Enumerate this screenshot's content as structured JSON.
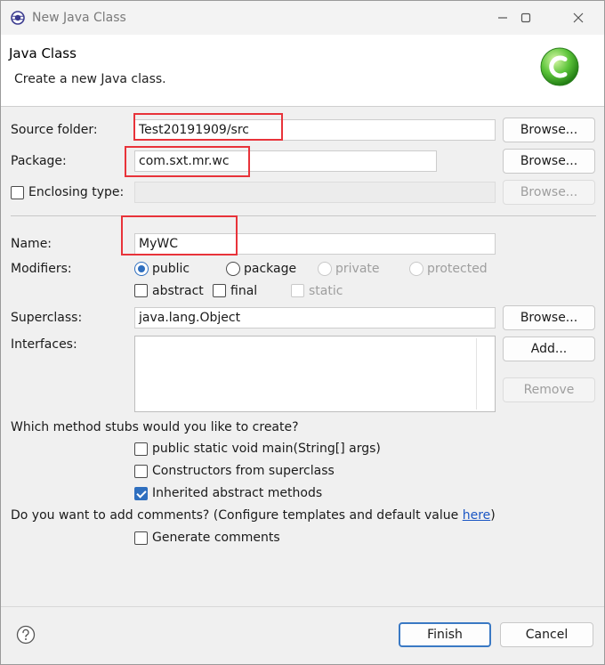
{
  "window": {
    "title": "New Java Class"
  },
  "banner": {
    "title": "Java Class",
    "description": "Create a new Java class."
  },
  "source_folder": {
    "label": "Source folder:",
    "value": "Test20191909/src",
    "browse": "Browse..."
  },
  "package": {
    "label": "Package:",
    "value": "com.sxt.mr.wc",
    "browse": "Browse..."
  },
  "enclosing": {
    "label": "Enclosing type:",
    "value": "",
    "browse": "Browse..."
  },
  "name": {
    "label": "Name:",
    "value": "MyWC"
  },
  "modifiers": {
    "label": "Modifiers:",
    "public": "public",
    "package": "package",
    "private": "private",
    "protected": "protected",
    "abstract": "abstract",
    "final": "final",
    "static": "static"
  },
  "superclass": {
    "label": "Superclass:",
    "value": "java.lang.Object",
    "browse": "Browse..."
  },
  "interfaces": {
    "label": "Interfaces:",
    "add": "Add...",
    "remove": "Remove"
  },
  "stubs": {
    "question": "Which method stubs would you like to create?",
    "main": "public static void main(String[] args)",
    "constructors": "Constructors from superclass",
    "inherited": "Inherited abstract methods"
  },
  "comments": {
    "question": "Do you want to add comments? (Configure templates and default value ",
    "link": "here",
    "close": ")",
    "generate": "Generate comments"
  },
  "footer": {
    "finish": "Finish",
    "cancel": "Cancel"
  },
  "colors": {
    "accent": "#2f6fbf",
    "highlight": "#e8333a"
  }
}
